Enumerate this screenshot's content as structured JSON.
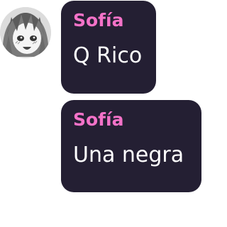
{
  "messages": [
    {
      "sender": "Sofía",
      "text": "Q Rico"
    },
    {
      "sender": "Sofía",
      "text": "Una negra"
    }
  ],
  "colors": {
    "bubble_background": "#241f33",
    "sender_name": "#f472c8",
    "message_text": "#ffffff"
  },
  "icons": {
    "avatar": "anime-girl-avatar-icon"
  }
}
